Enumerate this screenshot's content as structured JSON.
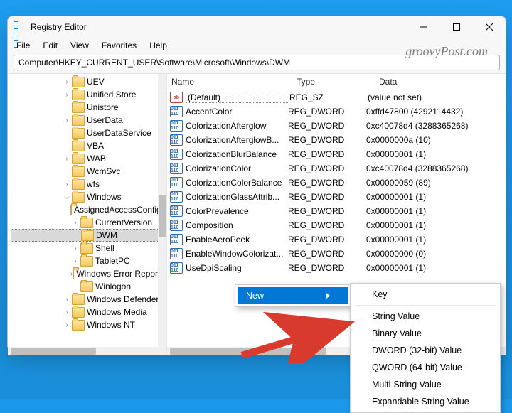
{
  "window": {
    "title": "Registry Editor",
    "menus": {
      "file": "File",
      "edit": "Edit",
      "view": "View",
      "favorites": "Favorites",
      "help": "Help"
    },
    "address": "Computer\\HKEY_CURRENT_USER\\Software\\Microsoft\\Windows\\DWM"
  },
  "tree": [
    {
      "indent": 6,
      "arrow": ">",
      "label": "UEV"
    },
    {
      "indent": 6,
      "arrow": ">",
      "label": "Unified Store"
    },
    {
      "indent": 6,
      "arrow": "",
      "label": "Unistore"
    },
    {
      "indent": 6,
      "arrow": ">",
      "label": "UserData"
    },
    {
      "indent": 6,
      "arrow": "",
      "label": "UserDataService"
    },
    {
      "indent": 6,
      "arrow": "",
      "label": "VBA"
    },
    {
      "indent": 6,
      "arrow": ">",
      "label": "WAB"
    },
    {
      "indent": 6,
      "arrow": "",
      "label": "WcmSvc"
    },
    {
      "indent": 6,
      "arrow": ">",
      "label": "wfs"
    },
    {
      "indent": 6,
      "arrow": "v",
      "label": "Windows"
    },
    {
      "indent": 7,
      "arrow": "",
      "label": "AssignedAccessConfiguration"
    },
    {
      "indent": 7,
      "arrow": ">",
      "label": "CurrentVersion"
    },
    {
      "indent": 7,
      "arrow": "",
      "label": "DWM",
      "selected": true
    },
    {
      "indent": 7,
      "arrow": ">",
      "label": "Shell"
    },
    {
      "indent": 7,
      "arrow": ">",
      "label": "TabletPC"
    },
    {
      "indent": 7,
      "arrow": ">",
      "label": "Windows Error Reporting"
    },
    {
      "indent": 7,
      "arrow": "",
      "label": "Winlogon"
    },
    {
      "indent": 6,
      "arrow": ">",
      "label": "Windows Defender"
    },
    {
      "indent": 6,
      "arrow": ">",
      "label": "Windows Media"
    },
    {
      "indent": 6,
      "arrow": ">",
      "label": "Windows NT"
    }
  ],
  "columns": {
    "name": "Name",
    "type": "Type",
    "data": "Data"
  },
  "values": [
    {
      "icon": "str",
      "name": "(Default)",
      "type": "REG_SZ",
      "data": "(value not set)",
      "default": true
    },
    {
      "icon": "dw",
      "name": "AccentColor",
      "type": "REG_DWORD",
      "data": "0xffd47800 (4292114432)"
    },
    {
      "icon": "dw",
      "name": "ColorizationAfterglow",
      "type": "REG_DWORD",
      "data": "0xc40078d4 (3288365268)"
    },
    {
      "icon": "dw",
      "name": "ColorizationAfterglowB...",
      "type": "REG_DWORD",
      "data": "0x0000000a (10)"
    },
    {
      "icon": "dw",
      "name": "ColorizationBlurBalance",
      "type": "REG_DWORD",
      "data": "0x00000001 (1)"
    },
    {
      "icon": "dw",
      "name": "ColorizationColor",
      "type": "REG_DWORD",
      "data": "0xc40078d4 (3288365268)"
    },
    {
      "icon": "dw",
      "name": "ColorizationColorBalance",
      "type": "REG_DWORD",
      "data": "0x00000059 (89)"
    },
    {
      "icon": "dw",
      "name": "ColorizationGlassAttrib...",
      "type": "REG_DWORD",
      "data": "0x00000001 (1)"
    },
    {
      "icon": "dw",
      "name": "ColorPrevalence",
      "type": "REG_DWORD",
      "data": "0x00000001 (1)"
    },
    {
      "icon": "dw",
      "name": "Composition",
      "type": "REG_DWORD",
      "data": "0x00000001 (1)"
    },
    {
      "icon": "dw",
      "name": "EnableAeroPeek",
      "type": "REG_DWORD",
      "data": "0x00000001 (1)"
    },
    {
      "icon": "dw",
      "name": "EnableWindowColorizat...",
      "type": "REG_DWORD",
      "data": "0x00000000 (0)"
    },
    {
      "icon": "dw",
      "name": "UseDpiScaling",
      "type": "REG_DWORD",
      "data": "0x00000001 (1)"
    }
  ],
  "ctx_parent": {
    "new": "New"
  },
  "ctx_new": {
    "key": "Key",
    "string": "String Value",
    "binary": "Binary Value",
    "dword": "DWORD (32-bit) Value",
    "qword": "QWORD (64-bit) Value",
    "multi": "Multi-String Value",
    "expand": "Expandable String Value"
  },
  "watermark": "groovyPost.com"
}
